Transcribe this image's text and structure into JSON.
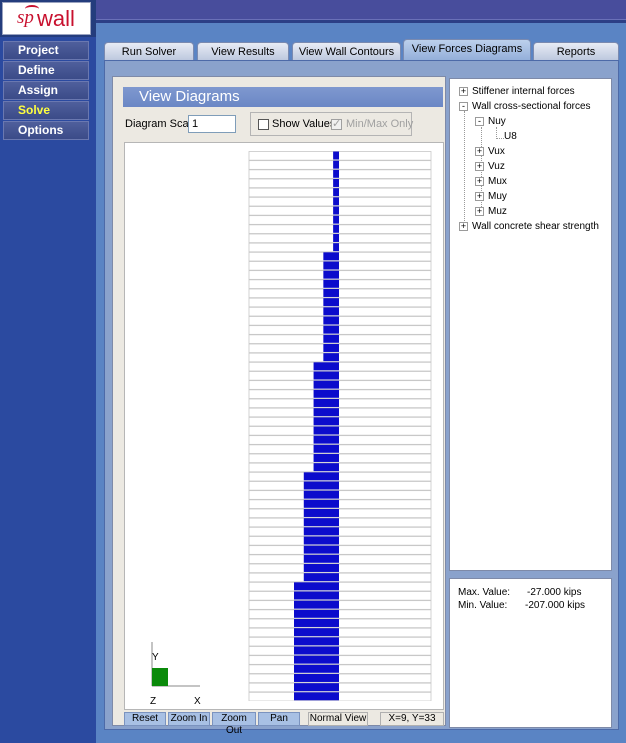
{
  "app": {
    "logo_sp": "sp",
    "logo_wall": "wall"
  },
  "sidebar": {
    "items": [
      {
        "label": "Project"
      },
      {
        "label": "Define"
      },
      {
        "label": "Assign"
      },
      {
        "label": "Solve",
        "active": true
      },
      {
        "label": "Options"
      }
    ]
  },
  "tabs": [
    {
      "label": "Run Solver"
    },
    {
      "label": "View Results"
    },
    {
      "label": "View Wall Contours"
    },
    {
      "label": "View Forces Diagrams",
      "active": true
    },
    {
      "label": "Reports"
    }
  ],
  "diagram": {
    "header": "View Diagrams",
    "scale_label": "Diagram Scale:",
    "scale_value": "1",
    "show_values_label": "Show Values",
    "show_values_checked": false,
    "minmax_label": "Min/Max Only",
    "minmax_checked": true,
    "minmax_enabled": false,
    "axis_y": "Y",
    "axis_z": "Z",
    "axis_x": "X",
    "colors": {
      "bar": "#0c0ccc",
      "axis_box": "#0a8a0a"
    }
  },
  "bottom_buttons": [
    {
      "label": "Reset"
    },
    {
      "label": "Zoom In"
    },
    {
      "label": "Zoom Out"
    },
    {
      "label": "Pan"
    },
    {
      "label": "Normal View"
    }
  ],
  "coords": "X=9, Y=33",
  "tree": {
    "items": [
      {
        "label": "Stiffener internal forces",
        "expander": "+"
      },
      {
        "label": "Wall cross-sectional forces",
        "expander": "-"
      },
      {
        "label": "Nuy",
        "expander": "-"
      },
      {
        "label": "U8"
      },
      {
        "label": "Vux",
        "expander": "+"
      },
      {
        "label": "Vuz",
        "expander": "+"
      },
      {
        "label": "Mux",
        "expander": "+"
      },
      {
        "label": "Muy",
        "expander": "+"
      },
      {
        "label": "Muz",
        "expander": "+"
      },
      {
        "label": "Wall concrete shear strength",
        "expander": "+"
      }
    ]
  },
  "info": {
    "max_label": "Max. Value:",
    "max_value": "-27.000 kips",
    "min_label": "Min. Value:",
    "min_value": "-207.000 kips"
  },
  "chart_data": {
    "type": "bar",
    "orientation": "horizontal",
    "rows": 60,
    "min_value": -207,
    "max_value": -27,
    "segments": [
      {
        "rows": 11,
        "value": -27
      },
      {
        "rows": 12,
        "value": -72
      },
      {
        "rows": 12,
        "value": -117
      },
      {
        "rows": 12,
        "value": -162
      },
      {
        "rows": 13,
        "value": -207
      }
    ]
  }
}
